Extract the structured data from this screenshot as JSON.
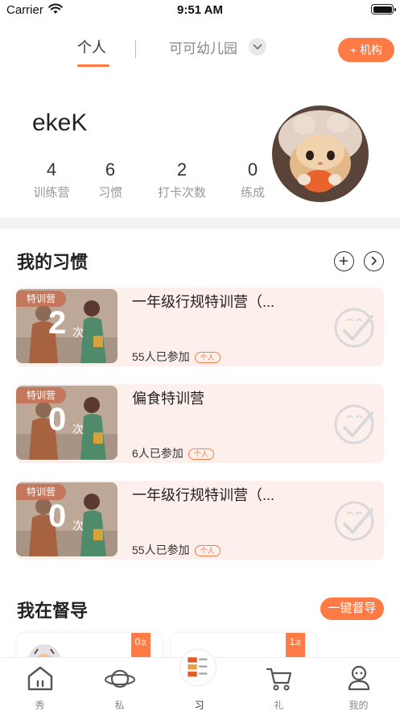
{
  "status_bar": {
    "carrier": "Carrier",
    "time": "9:51 AM"
  },
  "top_nav": {
    "tab_personal": "个人",
    "tab_school": "可可幼儿园",
    "org_button": "+ 机构"
  },
  "profile": {
    "username": "ekeK",
    "stats": [
      {
        "value": "4",
        "label": "训练营"
      },
      {
        "value": "6",
        "label": "习惯"
      },
      {
        "value": "2",
        "label": "打卡次数"
      },
      {
        "value": "0",
        "label": "练成"
      }
    ]
  },
  "habits": {
    "title": "我的习惯",
    "items": [
      {
        "tag": "特训营",
        "count": "2",
        "unit": "次",
        "name": "一年级行规特训营（...",
        "participants": "55人已参加",
        "badge": "个人"
      },
      {
        "tag": "特训营",
        "count": "0",
        "unit": "次",
        "name": "偏食特训营",
        "participants": "6人已参加",
        "badge": "个人"
      },
      {
        "tag": "特训营",
        "count": "0",
        "unit": "次",
        "name": "一年级行规特训营（...",
        "participants": "55人已参加",
        "badge": "个人"
      }
    ]
  },
  "supervise": {
    "title": "我在督导",
    "button": "一键督导",
    "cards": [
      {
        "count": "0",
        "unit": "次"
      },
      {
        "count": "1",
        "unit": "次"
      }
    ]
  },
  "tab_bar": {
    "items": [
      {
        "label": "秀",
        "icon": "house-icon"
      },
      {
        "label": "私",
        "icon": "planet-icon"
      },
      {
        "label": "习",
        "icon": "habit-thumbnail-icon"
      },
      {
        "label": "礼",
        "icon": "cart-icon"
      },
      {
        "label": "我的",
        "icon": "person-icon"
      }
    ],
    "active": "习"
  },
  "colors": {
    "accent": "#ff7a45",
    "card_bg": "#fdf0ec",
    "divider": "#f2f2f4"
  }
}
